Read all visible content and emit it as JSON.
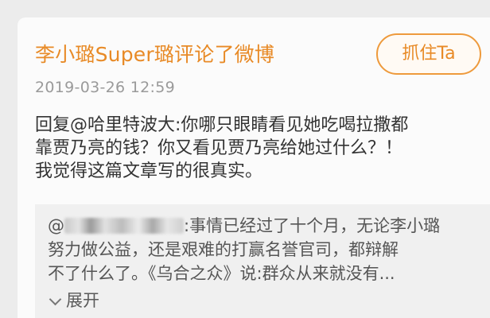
{
  "post": {
    "header_title": "李小璐Super璐评论了微博",
    "follow_label": "抓住Ta",
    "timestamp": "2019-03-26 12:59",
    "reply_lines": [
      "回复@哈里特波大:你哪只眼睛看见她吃喝拉撒都",
      "靠贾乃亮的钱？你又看见贾乃亮给她过什么？！",
      "我觉得这篇文章写的很真实。"
    ]
  },
  "quoted": {
    "name_prefix": "@",
    "line1_suffix": ":事情已经过了十个月，无论李小璐",
    "line2": "努力做公益，还是艰难的打赢名誉官司，都辩解",
    "line3": "不了什么了。《乌合之众》说:群众从来就没有...",
    "expand_label": "展开"
  }
}
